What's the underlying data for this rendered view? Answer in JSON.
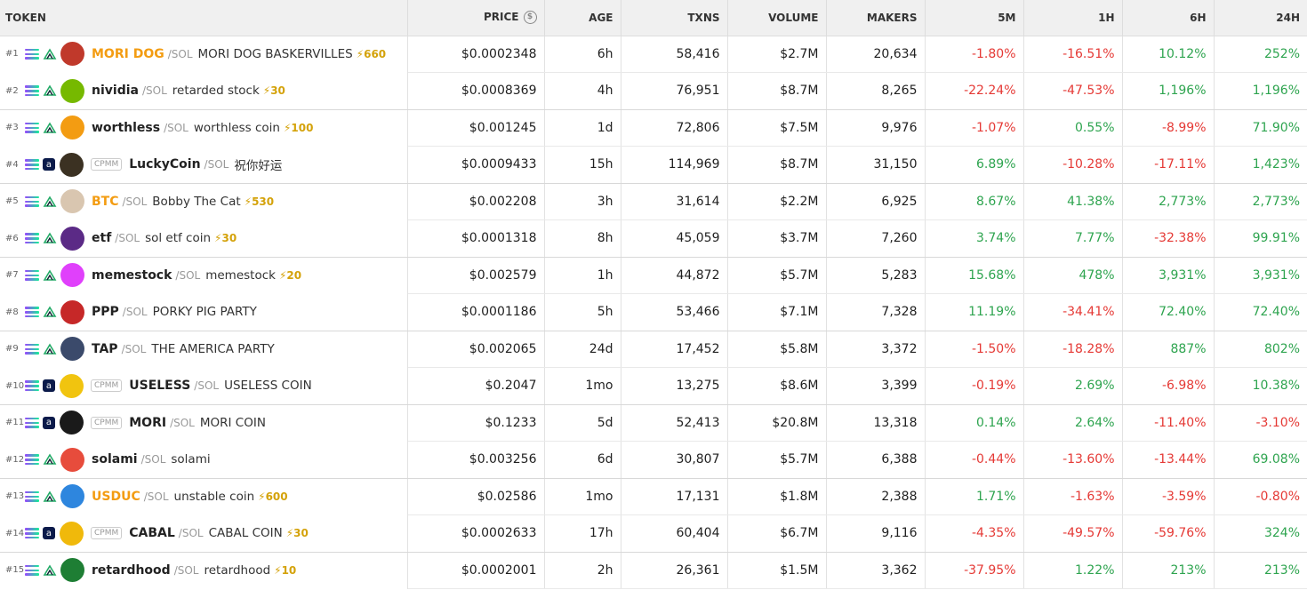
{
  "headers": {
    "token": "TOKEN",
    "price": "PRICE",
    "age": "AGE",
    "txns": "TXNS",
    "volume": "VOLUME",
    "makers": "MAKERS",
    "m5": "5M",
    "h1": "1H",
    "h6": "6H",
    "h24": "24H"
  },
  "pair_suffix": "/SOL",
  "cpmm_label": "CPMM",
  "colors": {
    "negative": "#e53935",
    "positive": "#2ea44f",
    "boost": "#d4a20a",
    "highlight_symbol": "#f39c12"
  },
  "rows": [
    {
      "rank": "#1",
      "dex": "raydium",
      "cpmm": false,
      "logo_color": "#c0392b",
      "sym": "MORI DOG",
      "hot": true,
      "name": "MORI DOG BASKERVILLES",
      "boost": "⚡660",
      "price": "$0.0002348",
      "age": "6h",
      "txns": "58,416",
      "volume": "$2.7M",
      "makers": "20,634",
      "m5": "-1.80%",
      "h1": "-16.51%",
      "h6": "10.12%",
      "h24": "252%"
    },
    {
      "rank": "#2",
      "dex": "raydium",
      "cpmm": false,
      "logo_color": "#76b900",
      "sym": "nividia",
      "hot": false,
      "name": "retarded stock",
      "boost": "⚡30",
      "price": "$0.0008369",
      "age": "4h",
      "txns": "76,951",
      "volume": "$8.7M",
      "makers": "8,265",
      "m5": "-22.24%",
      "h1": "-47.53%",
      "h6": "1,196%",
      "h24": "1,196%"
    },
    {
      "rank": "#3",
      "dex": "raydium",
      "cpmm": false,
      "logo_color": "#f39c12",
      "sym": "worthless",
      "hot": false,
      "name": "worthless coin",
      "boost": "⚡100",
      "price": "$0.001245",
      "age": "1d",
      "txns": "72,806",
      "volume": "$7.5M",
      "makers": "9,976",
      "m5": "-1.07%",
      "h1": "0.55%",
      "h6": "-8.99%",
      "h24": "71.90%"
    },
    {
      "rank": "#4",
      "dex": "box",
      "cpmm": true,
      "logo_color": "#3b3122",
      "sym": "LuckyCoin",
      "hot": false,
      "name": "祝你好运",
      "boost": "",
      "price": "$0.0009433",
      "age": "15h",
      "txns": "114,969",
      "volume": "$8.7M",
      "makers": "31,150",
      "m5": "6.89%",
      "h1": "-10.28%",
      "h6": "-17.11%",
      "h24": "1,423%"
    },
    {
      "rank": "#5",
      "dex": "raydium",
      "cpmm": false,
      "logo_color": "#d9c6b0",
      "sym": "BTC",
      "hot": true,
      "name": "Bobby The Cat",
      "boost": "⚡530",
      "price": "$0.002208",
      "age": "3h",
      "txns": "31,614",
      "volume": "$2.2M",
      "makers": "6,925",
      "m5": "8.67%",
      "h1": "41.38%",
      "h6": "2,773%",
      "h24": "2,773%"
    },
    {
      "rank": "#6",
      "dex": "raydium",
      "cpmm": false,
      "logo_color": "#5b2a86",
      "sym": "etf",
      "hot": false,
      "name": "sol etf coin",
      "boost": "⚡30",
      "price": "$0.0001318",
      "age": "8h",
      "txns": "45,059",
      "volume": "$3.7M",
      "makers": "7,260",
      "m5": "3.74%",
      "h1": "7.77%",
      "h6": "-32.38%",
      "h24": "99.91%"
    },
    {
      "rank": "#7",
      "dex": "raydium",
      "cpmm": false,
      "logo_color": "#e040fb",
      "sym": "memestock",
      "hot": false,
      "name": "memestock",
      "boost": "⚡20",
      "price": "$0.002579",
      "age": "1h",
      "txns": "44,872",
      "volume": "$5.7M",
      "makers": "5,283",
      "m5": "15.68%",
      "h1": "478%",
      "h6": "3,931%",
      "h24": "3,931%"
    },
    {
      "rank": "#8",
      "dex": "raydium",
      "cpmm": false,
      "logo_color": "#c62828",
      "sym": "PPP",
      "hot": false,
      "name": "PORKY PIG PARTY",
      "boost": "",
      "price": "$0.0001186",
      "age": "5h",
      "txns": "53,466",
      "volume": "$7.1M",
      "makers": "7,328",
      "m5": "11.19%",
      "h1": "-34.41%",
      "h6": "72.40%",
      "h24": "72.40%"
    },
    {
      "rank": "#9",
      "dex": "raydium",
      "cpmm": false,
      "logo_color": "#3b4a6b",
      "sym": "TAP",
      "hot": false,
      "name": "THE AMERICA PARTY",
      "boost": "",
      "price": "$0.002065",
      "age": "24d",
      "txns": "17,452",
      "volume": "$5.8M",
      "makers": "3,372",
      "m5": "-1.50%",
      "h1": "-18.28%",
      "h6": "887%",
      "h24": "802%"
    },
    {
      "rank": "#10",
      "dex": "box",
      "cpmm": true,
      "logo_color": "#f1c40f",
      "sym": "USELESS",
      "hot": false,
      "name": "USELESS COIN",
      "boost": "",
      "price": "$0.2047",
      "age": "1mo",
      "txns": "13,275",
      "volume": "$8.6M",
      "makers": "3,399",
      "m5": "-0.19%",
      "h1": "2.69%",
      "h6": "-6.98%",
      "h24": "10.38%"
    },
    {
      "rank": "#11",
      "dex": "box",
      "cpmm": true,
      "logo_color": "#1a1a1a",
      "sym": "MORI",
      "hot": false,
      "name": "MORI COIN",
      "boost": "",
      "price": "$0.1233",
      "age": "5d",
      "txns": "52,413",
      "volume": "$20.8M",
      "makers": "13,318",
      "m5": "0.14%",
      "h1": "2.64%",
      "h6": "-11.40%",
      "h24": "-3.10%"
    },
    {
      "rank": "#12",
      "dex": "raydium",
      "cpmm": false,
      "logo_color": "#e74c3c",
      "sym": "solami",
      "hot": false,
      "name": "solami",
      "boost": "",
      "price": "$0.003256",
      "age": "6d",
      "txns": "30,807",
      "volume": "$5.7M",
      "makers": "6,388",
      "m5": "-0.44%",
      "h1": "-13.60%",
      "h6": "-13.44%",
      "h24": "69.08%"
    },
    {
      "rank": "#13",
      "dex": "raydium",
      "cpmm": false,
      "logo_color": "#2e86de",
      "sym": "USDUC",
      "hot": true,
      "name": "unstable coin",
      "boost": "⚡600",
      "price": "$0.02586",
      "age": "1mo",
      "txns": "17,131",
      "volume": "$1.8M",
      "makers": "2,388",
      "m5": "1.71%",
      "h1": "-1.63%",
      "h6": "-3.59%",
      "h24": "-0.80%"
    },
    {
      "rank": "#14",
      "dex": "box",
      "cpmm": true,
      "logo_color": "#f0b90b",
      "sym": "CABAL",
      "hot": false,
      "name": "CABAL COIN",
      "boost": "⚡30",
      "price": "$0.0002633",
      "age": "17h",
      "txns": "60,404",
      "volume": "$6.7M",
      "makers": "9,116",
      "m5": "-4.35%",
      "h1": "-49.57%",
      "h6": "-59.76%",
      "h24": "324%"
    },
    {
      "rank": "#15",
      "dex": "raydium",
      "cpmm": false,
      "logo_color": "#1e7e34",
      "sym": "retardhood",
      "hot": false,
      "name": "retardhood",
      "boost": "⚡10",
      "price": "$0.0002001",
      "age": "2h",
      "txns": "26,361",
      "volume": "$1.5M",
      "makers": "3,362",
      "m5": "-37.95%",
      "h1": "1.22%",
      "h6": "213%",
      "h24": "213%"
    }
  ]
}
